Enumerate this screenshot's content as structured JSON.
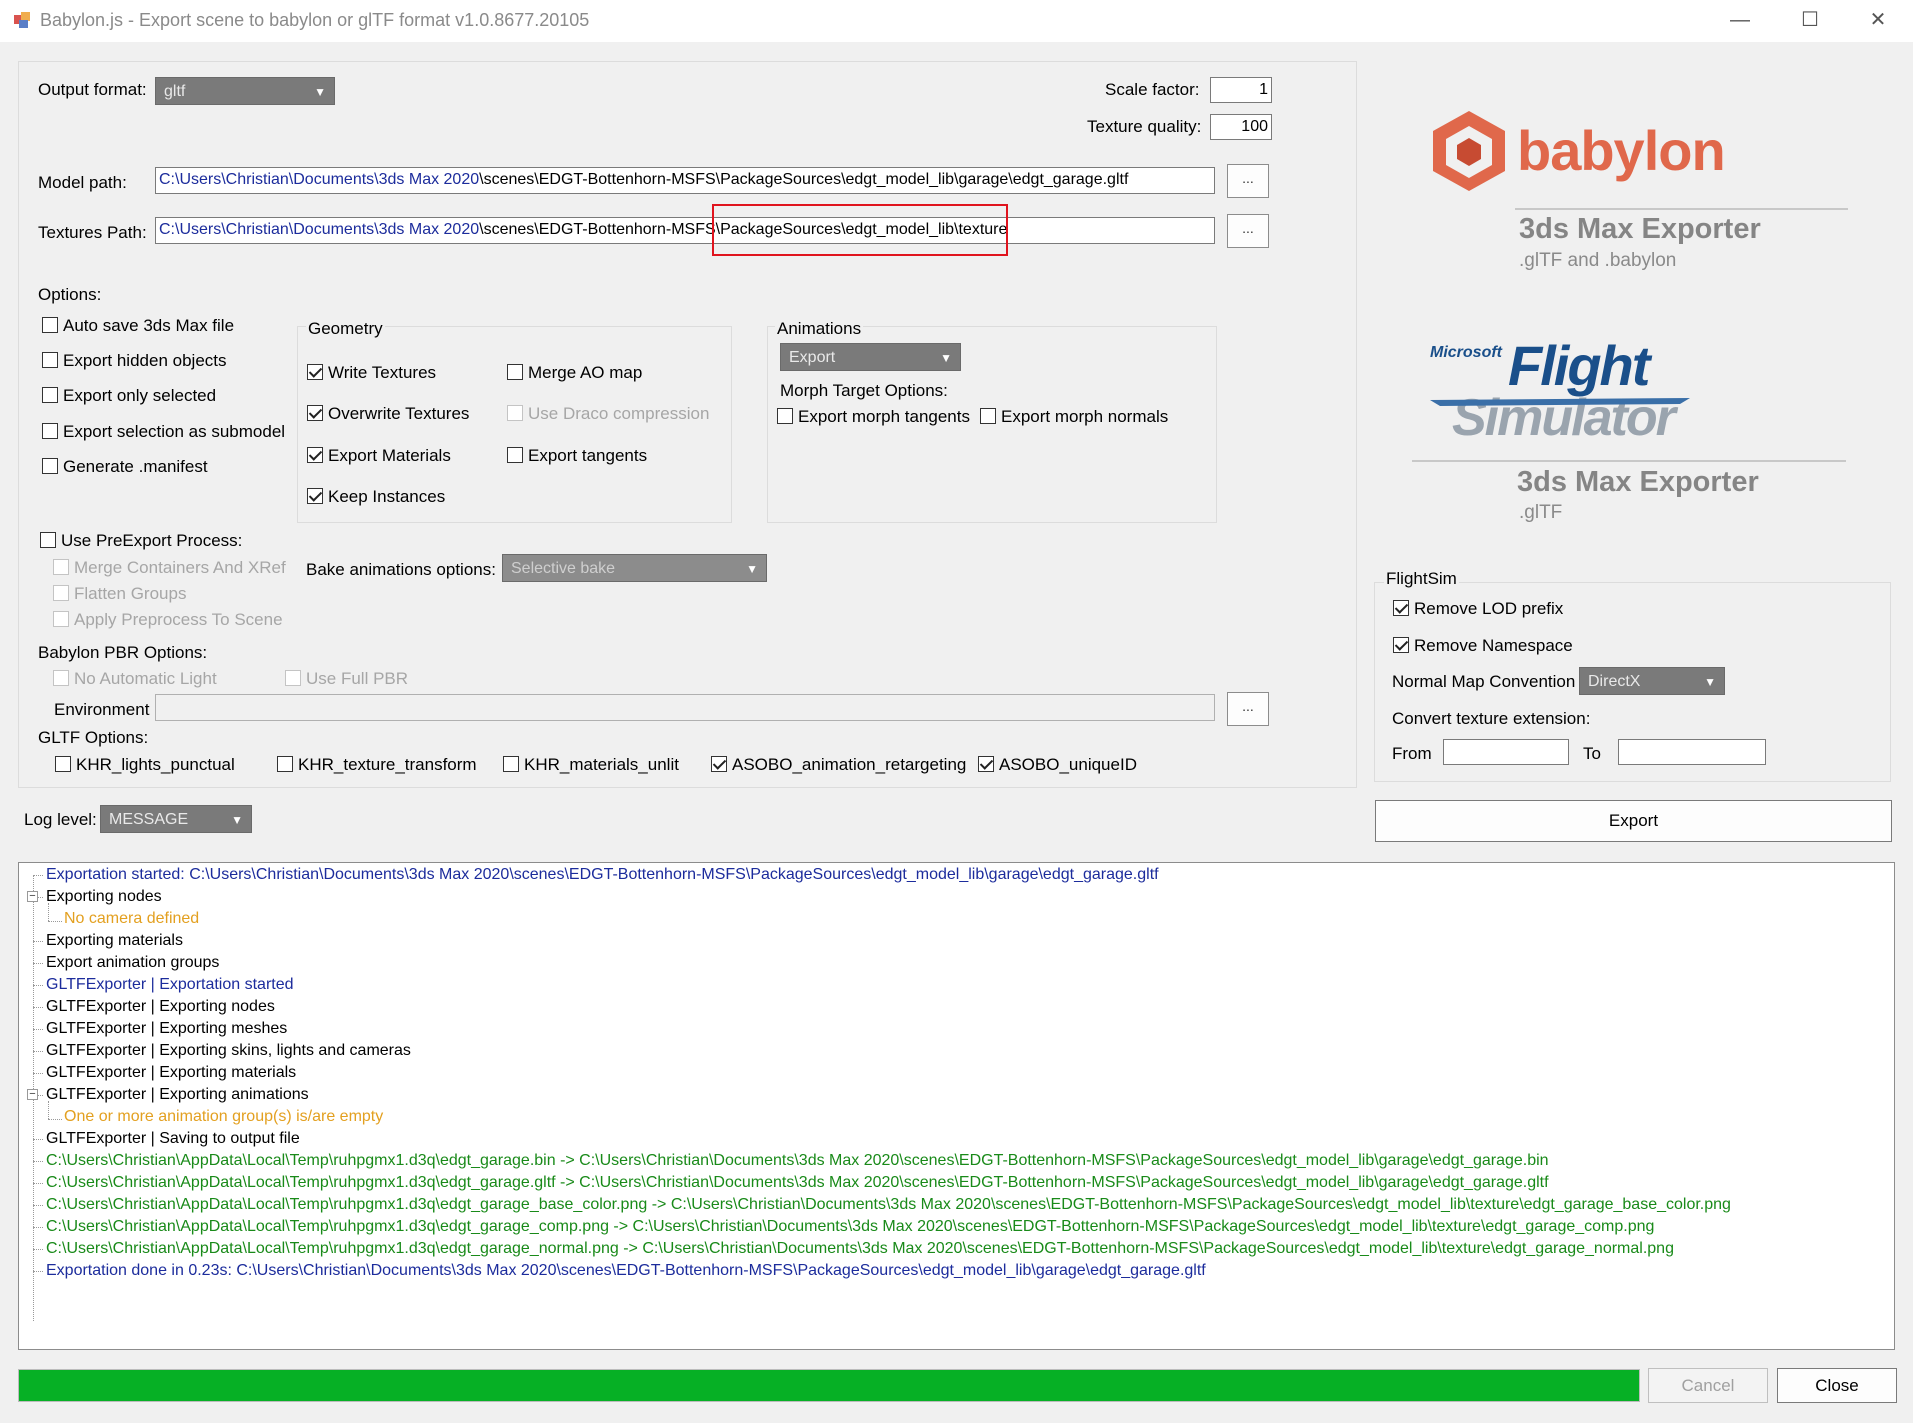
{
  "window": {
    "title": "Babylon.js - Export scene to babylon or glTF format v1.0.8677.20105",
    "controls": [
      "—",
      "☐",
      "✕"
    ]
  },
  "output_format": {
    "label": "Output format:",
    "value": "gltf"
  },
  "scale_factor": {
    "label": "Scale factor:",
    "value": "1"
  },
  "texture_quality": {
    "label": "Texture quality:",
    "value": "100"
  },
  "model_path": {
    "label": "Model path:",
    "value_prefix": "C:\\Users\\Christian\\Documents\\3ds Max 2020",
    "value_rest": "\\scenes\\EDGT-Bottenhorn-MSFS\\PackageSources\\edgt_model_lib\\garage\\edgt_garage.gltf",
    "browse": "..."
  },
  "textures_path": {
    "label": "Textures Path:",
    "value_prefix": "C:\\Users\\Christian\\Documents\\3ds Max 2020",
    "value_mid": "\\scenes\\EDGT-Bottenhorn-MSFS\\",
    "value_highlight": "PackageSources\\edgt_model_lib\\texture",
    "browse": "...",
    "highlight_color": "#e0141e"
  },
  "options": {
    "label": "Options:",
    "items": [
      {
        "label": "Auto save 3ds Max file",
        "checked": false
      },
      {
        "label": "Export hidden objects",
        "checked": false
      },
      {
        "label": "Export only selected",
        "checked": false
      },
      {
        "label": "Export selection as submodel",
        "checked": false
      },
      {
        "label": "Generate .manifest",
        "checked": false
      }
    ]
  },
  "geometry": {
    "title": "Geometry",
    "left": [
      {
        "label": "Write Textures",
        "checked": true
      },
      {
        "label": "Overwrite Textures",
        "checked": true
      },
      {
        "label": "Export Materials",
        "checked": true
      },
      {
        "label": "Keep Instances",
        "checked": true
      }
    ],
    "right": [
      {
        "label": "Merge AO map",
        "checked": false,
        "disabled": false
      },
      {
        "label": "Use Draco compression",
        "checked": false,
        "disabled": true
      },
      {
        "label": "Export tangents",
        "checked": false,
        "disabled": false
      }
    ]
  },
  "animations": {
    "title": "Animations",
    "combo": "Export",
    "morph_label": "Morph Target Options:",
    "morph_tangents": "Export morph tangents",
    "morph_normals": "Export morph normals"
  },
  "preexport": {
    "label": "Use PreExport Process:",
    "items": [
      "Merge Containers And XRef",
      "Flatten Groups",
      "Apply Preprocess To Scene"
    ]
  },
  "bake": {
    "label": "Bake animations options:",
    "value": "Selective bake"
  },
  "pbr": {
    "label": "Babylon PBR Options:",
    "no_auto_light": "No Automatic Light",
    "use_full_pbr": "Use Full PBR",
    "environment_label": "Environment",
    "environment_value": "",
    "browse": "..."
  },
  "gltf_options": {
    "label": "GLTF Options:",
    "items": [
      {
        "label": "KHR_lights_punctual",
        "checked": false
      },
      {
        "label": "KHR_texture_transform",
        "checked": false
      },
      {
        "label": "KHR_materials_unlit",
        "checked": false
      },
      {
        "label": "ASOBO_animation_retargeting",
        "checked": true
      },
      {
        "label": "ASOBO_uniqueID",
        "checked": true
      }
    ]
  },
  "log_level": {
    "label": "Log level:",
    "value": "MESSAGE"
  },
  "brand": {
    "babylon_word": "babylon",
    "babylon_sub": "3ds Max Exporter",
    "babylon_sub2": ".glTF and .babylon",
    "ms_word": "Microsoft",
    "fs_word1": "Flight",
    "fs_word2": "Simulator",
    "fs_sub": "3ds Max Exporter",
    "fs_sub2": ".glTF",
    "babylon_color": "#e0684b",
    "fs_blue": "#1a4f8a"
  },
  "flightsim": {
    "title": "FlightSim",
    "remove_lod": "Remove LOD prefix",
    "remove_namespace": "Remove Namespace",
    "normal_map_label": "Normal Map Convention",
    "normal_map_value": "DirectX",
    "convert_label": "Convert texture extension:",
    "from_label": "From",
    "to_label": "To",
    "from_value": "",
    "to_value": ""
  },
  "export_button": "Export",
  "log": [
    {
      "text": "Exportation started: C:\\Users\\Christian\\Documents\\3ds Max 2020\\scenes\\EDGT-Bottenhorn-MSFS\\PackageSources\\edgt_model_lib\\garage\\edgt_garage.gltf",
      "color": "blue",
      "indent": 0
    },
    {
      "text": "Exporting nodes",
      "color": "black",
      "indent": 0,
      "expander": "−"
    },
    {
      "text": "No camera defined",
      "color": "orange",
      "indent": 1
    },
    {
      "text": "Exporting materials",
      "color": "black",
      "indent": 0
    },
    {
      "text": "Export animation groups",
      "color": "black",
      "indent": 0
    },
    {
      "text": "GLTFExporter | Exportation started",
      "color": "blue",
      "indent": 0
    },
    {
      "text": "GLTFExporter | Exporting nodes",
      "color": "black",
      "indent": 0
    },
    {
      "text": "GLTFExporter | Exporting meshes",
      "color": "black",
      "indent": 0
    },
    {
      "text": "GLTFExporter | Exporting skins, lights and cameras",
      "color": "black",
      "indent": 0
    },
    {
      "text": "GLTFExporter | Exporting materials",
      "color": "black",
      "indent": 0
    },
    {
      "text": "GLTFExporter | Exporting animations",
      "color": "black",
      "indent": 0,
      "expander": "−"
    },
    {
      "text": "One or more animation group(s) is/are empty",
      "color": "orange",
      "indent": 1
    },
    {
      "text": "GLTFExporter | Saving to output file",
      "color": "black",
      "indent": 0
    },
    {
      "text": "C:\\Users\\Christian\\AppData\\Local\\Temp\\ruhpgmx1.d3q\\edgt_garage.bin -> C:\\Users\\Christian\\Documents\\3ds Max 2020\\scenes\\EDGT-Bottenhorn-MSFS\\PackageSources\\edgt_model_lib\\garage\\edgt_garage.bin",
      "color": "green",
      "indent": 0
    },
    {
      "text": "C:\\Users\\Christian\\AppData\\Local\\Temp\\ruhpgmx1.d3q\\edgt_garage.gltf -> C:\\Users\\Christian\\Documents\\3ds Max 2020\\scenes\\EDGT-Bottenhorn-MSFS\\PackageSources\\edgt_model_lib\\garage\\edgt_garage.gltf",
      "color": "green",
      "indent": 0
    },
    {
      "text": "C:\\Users\\Christian\\AppData\\Local\\Temp\\ruhpgmx1.d3q\\edgt_garage_base_color.png -> C:\\Users\\Christian\\Documents\\3ds Max 2020\\scenes\\EDGT-Bottenhorn-MSFS\\PackageSources\\edgt_model_lib\\texture\\edgt_garage_base_color.png",
      "color": "green",
      "indent": 0
    },
    {
      "text": "C:\\Users\\Christian\\AppData\\Local\\Temp\\ruhpgmx1.d3q\\edgt_garage_comp.png -> C:\\Users\\Christian\\Documents\\3ds Max 2020\\scenes\\EDGT-Bottenhorn-MSFS\\PackageSources\\edgt_model_lib\\texture\\edgt_garage_comp.png",
      "color": "green",
      "indent": 0
    },
    {
      "text": "C:\\Users\\Christian\\AppData\\Local\\Temp\\ruhpgmx1.d3q\\edgt_garage_normal.png -> C:\\Users\\Christian\\Documents\\3ds Max 2020\\scenes\\EDGT-Bottenhorn-MSFS\\PackageSources\\edgt_model_lib\\texture\\edgt_garage_normal.png",
      "color": "green",
      "indent": 0
    },
    {
      "text": "Exportation done in 0.23s: C:\\Users\\Christian\\Documents\\3ds Max 2020\\scenes\\EDGT-Bottenhorn-MSFS\\PackageSources\\edgt_model_lib\\garage\\edgt_garage.gltf",
      "color": "blue",
      "indent": 0
    }
  ],
  "progress": {
    "value": 1.0,
    "color": "#06b025"
  },
  "cancel_button": "Cancel",
  "close_button": "Close"
}
